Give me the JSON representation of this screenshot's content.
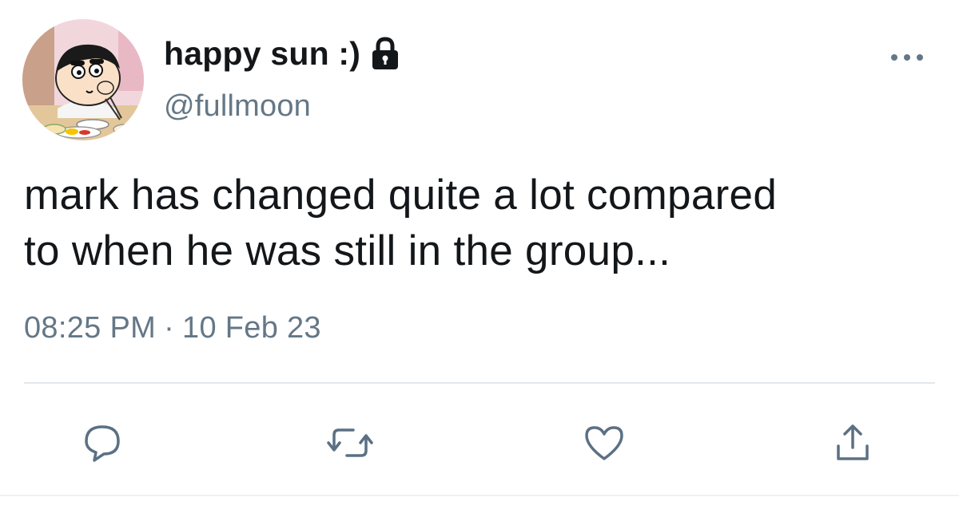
{
  "user": {
    "display_name": "happy sun :)",
    "handle": "@fullmoon",
    "protected": true,
    "avatar_icon": "cartoon-boy-avatar"
  },
  "tweet": {
    "line1": "mark has changed quite a lot compared",
    "line2": "to when he was still in the group...",
    "time": "08:25 PM",
    "separator": "·",
    "date": "10 Feb 23"
  },
  "actions": {
    "reply_icon": "reply-icon",
    "retweet_icon": "retweet-icon",
    "like_icon": "heart-icon",
    "share_icon": "share-icon"
  },
  "colors": {
    "text": "#14171a",
    "secondary": "#657786",
    "icon": "#5b7083",
    "divider": "#e1e8ed"
  }
}
